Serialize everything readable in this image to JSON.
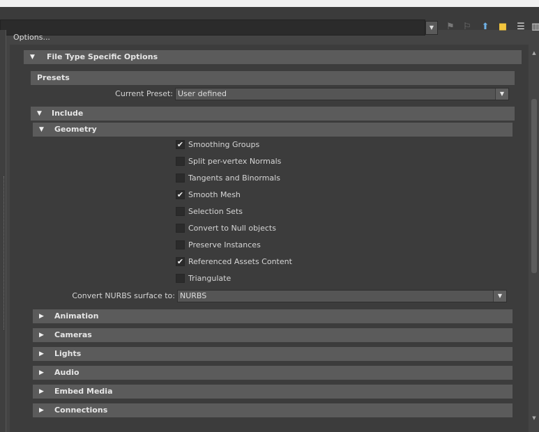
{
  "toolbar": {
    "path_value": "",
    "icons": [
      "dropdown-arrow-icon",
      "bookmark-icon",
      "bookmark-add-icon",
      "up-folder-icon",
      "new-folder-icon",
      "list-view-icon",
      "detail-view-icon"
    ]
  },
  "options_label": "Options...",
  "file_type_section": {
    "label": "File Type Specific Options",
    "expanded": true
  },
  "presets": {
    "label": "Presets",
    "current_preset_label": "Current Preset:",
    "current_preset_value": "User defined"
  },
  "include": {
    "label": "Include",
    "expanded": true
  },
  "geometry": {
    "label": "Geometry",
    "expanded": true,
    "options": [
      {
        "label": "Smoothing Groups",
        "checked": true
      },
      {
        "label": "Split per-vertex Normals",
        "checked": false
      },
      {
        "label": "Tangents and Binormals",
        "checked": false
      },
      {
        "label": "Smooth Mesh",
        "checked": true
      },
      {
        "label": "Selection Sets",
        "checked": false
      },
      {
        "label": "Convert to Null objects",
        "checked": false
      },
      {
        "label": "Preserve Instances",
        "checked": false
      },
      {
        "label": "Referenced Assets Content",
        "checked": true
      },
      {
        "label": "Triangulate",
        "checked": false
      }
    ],
    "nurbs_label": "Convert NURBS surface to:",
    "nurbs_value": "NURBS"
  },
  "collapsed_sections": [
    {
      "label": "Animation"
    },
    {
      "label": "Cameras"
    },
    {
      "label": "Lights"
    },
    {
      "label": "Audio"
    },
    {
      "label": "Embed Media"
    },
    {
      "label": "Connections"
    }
  ],
  "check_glyph": "✔",
  "colors": {
    "panel": "#3c3c3c",
    "frame_header": "#5b5b5b",
    "accent_icon": "#6fb1e6",
    "folder_icon": "#f2c53d"
  }
}
